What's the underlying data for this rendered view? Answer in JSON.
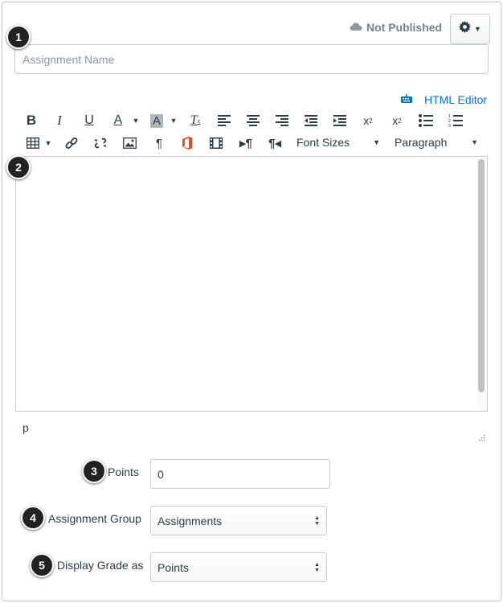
{
  "header": {
    "status_label": "Not Published",
    "status_icon": "cloud-icon",
    "settings_icon": "gear-icon"
  },
  "assignment_name": {
    "value": "",
    "placeholder": "Assignment Name"
  },
  "editor": {
    "html_editor_label": "HTML Editor",
    "font_sizes_label": "Font Sizes",
    "paragraph_label": "Paragraph",
    "path_text": "p",
    "toolbar_row1": [
      "bold-icon",
      "italic-icon",
      "underline-icon",
      "text-color-icon",
      "background-color-icon",
      "clear-formatting-icon",
      "align-left-icon",
      "align-center-icon",
      "align-right-icon",
      "outdent-icon",
      "indent-icon",
      "superscript-icon",
      "subscript-icon",
      "bulleted-list-icon",
      "numbered-list-icon"
    ],
    "toolbar_row2": [
      "table-icon",
      "link-icon",
      "unlink-icon",
      "image-icon",
      "pilcrow-icon",
      "office-icon",
      "media-icon",
      "ltr-icon",
      "rtl-icon"
    ]
  },
  "badges": [
    "1",
    "2",
    "3",
    "4",
    "5"
  ],
  "points": {
    "label": "Points",
    "value": "0"
  },
  "assignment_group": {
    "label": "Assignment Group",
    "selected": "Assignments"
  },
  "display_grade": {
    "label": "Display Grade as",
    "selected": "Points"
  },
  "colors": {
    "link": "#0770d7",
    "text": "#2d3b45",
    "border": "#c7cdd1",
    "office": "#e64c1c"
  }
}
